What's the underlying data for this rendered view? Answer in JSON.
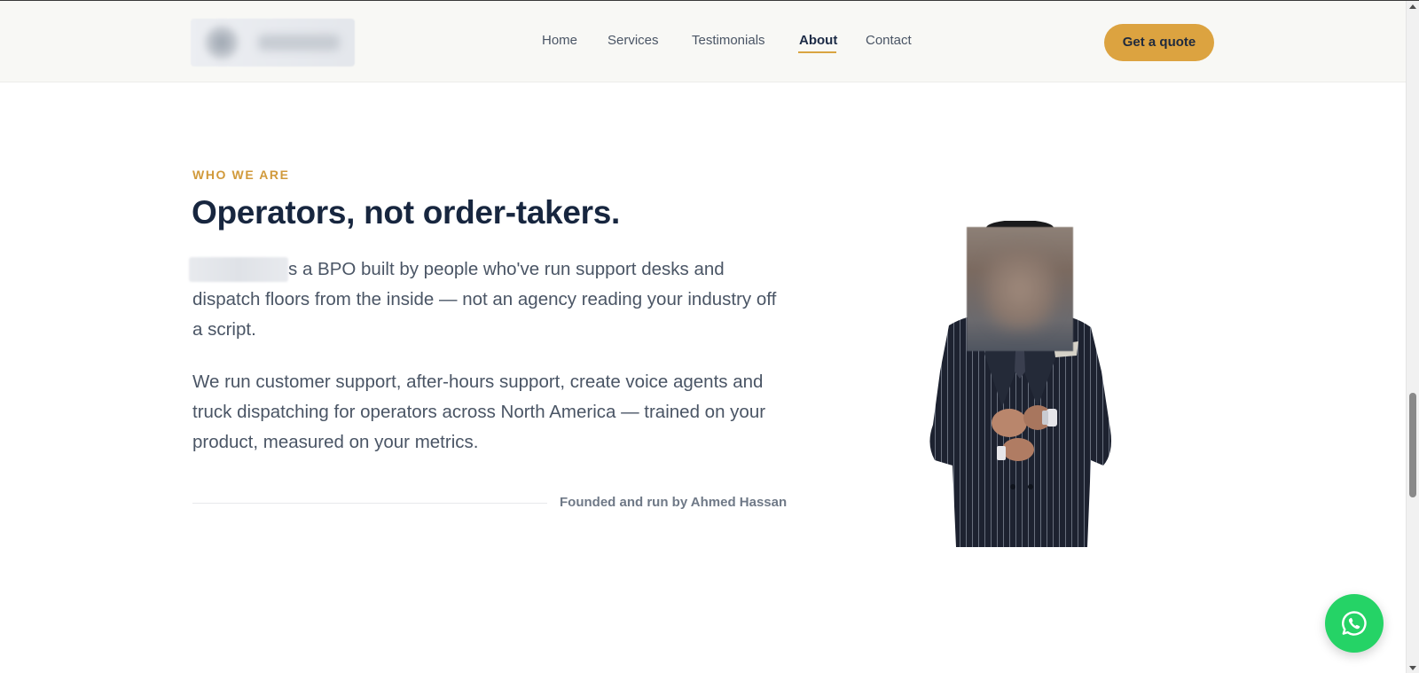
{
  "header": {
    "nav": [
      {
        "label": "Home",
        "active": false
      },
      {
        "label": "Services",
        "active": false
      },
      {
        "label": "Testimonials",
        "active": false
      },
      {
        "label": "About",
        "active": true
      },
      {
        "label": "Contact",
        "active": false
      }
    ],
    "cta_label": "Get a quote"
  },
  "about": {
    "eyebrow": "WHO WE ARE",
    "headline": "Operators, not order-takers.",
    "paragraph_1_visible": "s a BPO built by people who've run support desks and dispatch floors from the inside — not an agency reading your industry off a script.",
    "paragraph_2": "We run customer support, after-hours support, create voice agents and truck dispatching for operators across North America — trained on your product, measured on your metrics.",
    "founder_note": "Founded and run by Ahmed Hassan"
  },
  "colors": {
    "accent": "#dca340",
    "heading": "#17263f",
    "body_text": "#4a5565",
    "whatsapp": "#25d366",
    "header_bg": "#f8f8f5"
  },
  "icons": {
    "floating_button": "whatsapp-icon"
  }
}
